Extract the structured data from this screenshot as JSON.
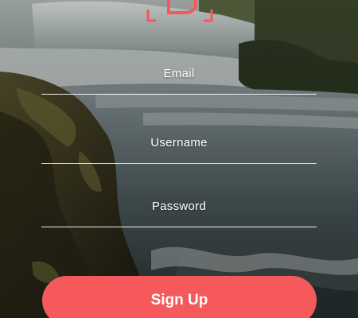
{
  "brand": {
    "logo_letter": "B",
    "accent_color": "#f5595b"
  },
  "form": {
    "email_label": "Email",
    "username_label": "Username",
    "password_label": "Password"
  },
  "actions": {
    "signup_label": "Sign Up"
  },
  "background": {
    "scene": "waterfall-photo"
  }
}
